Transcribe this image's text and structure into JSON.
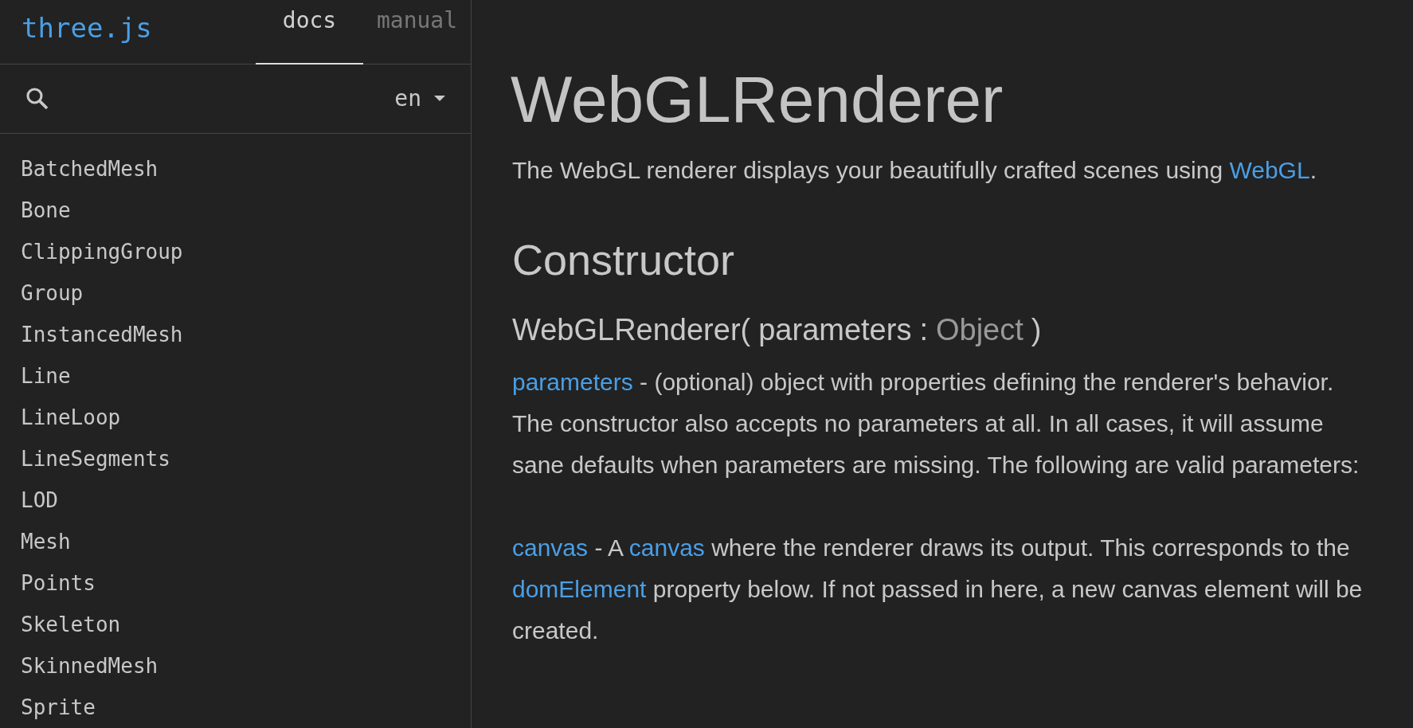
{
  "header": {
    "logo": "three.js",
    "tabs": [
      {
        "label": "docs",
        "selected": true
      },
      {
        "label": "manual",
        "selected": false
      }
    ]
  },
  "search": {
    "language": "en"
  },
  "sidebar": {
    "items": [
      "BatchedMesh",
      "Bone",
      "ClippingGroup",
      "Group",
      "InstancedMesh",
      "Line",
      "LineLoop",
      "LineSegments",
      "LOD",
      "Mesh",
      "Points",
      "Skeleton",
      "SkinnedMesh",
      "Sprite"
    ]
  },
  "content": {
    "title": "WebGLRenderer",
    "intro": [
      {
        "kind": "text",
        "text": "The WebGL renderer displays your beautifully crafted scenes using "
      },
      {
        "kind": "link",
        "text": "WebGL"
      },
      {
        "kind": "text",
        "text": "."
      }
    ],
    "section": "Constructor",
    "signature": {
      "name": "WebGLRenderer(",
      "param": "parameters",
      "separator": ":",
      "type": "Object",
      "close": ")"
    },
    "paragraphs": [
      [
        {
          "kind": "link",
          "text": "parameters"
        },
        {
          "kind": "text",
          "text": " - (optional) object with properties defining the renderer's behavior. The constructor also accepts no parameters at all. In all cases, it will assume sane defaults when parameters are missing. The following are valid parameters:"
        }
      ],
      [
        {
          "kind": "link",
          "text": "canvas"
        },
        {
          "kind": "text",
          "text": " - A "
        },
        {
          "kind": "link",
          "text": "canvas"
        },
        {
          "kind": "text",
          "text": " where the renderer draws its output. This corresponds to the "
        },
        {
          "kind": "link",
          "text": "domElement"
        },
        {
          "kind": "text",
          "text": " property below. If not passed in here, a new canvas element will be created."
        }
      ]
    ]
  }
}
